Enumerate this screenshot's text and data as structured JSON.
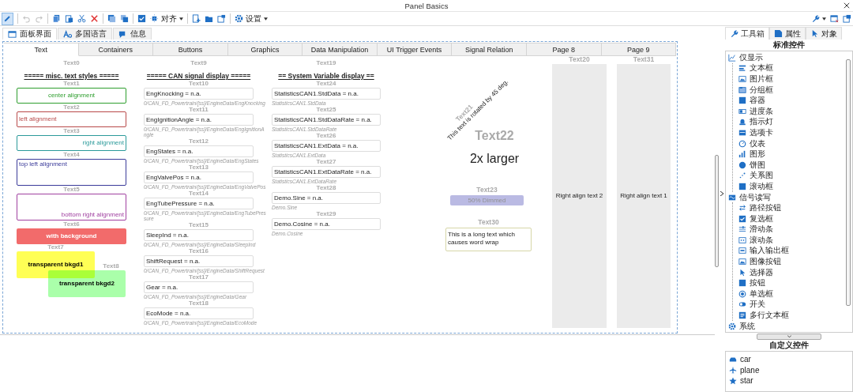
{
  "window": {
    "title": "Panel Basics"
  },
  "toolbar": {
    "edit_mode": true,
    "history": [
      {
        "disabled": true
      },
      {
        "disabled": true
      }
    ],
    "align_label": "对齐",
    "settings_label": "设置"
  },
  "view_tabs": [
    {
      "label": "面板界面",
      "selected": true
    },
    {
      "label": "多国语言",
      "selected": false
    },
    {
      "label": "信息",
      "selected": false
    }
  ],
  "page_tabs": [
    {
      "label": "Text",
      "selected": true
    },
    {
      "label": "Containers",
      "selected": false
    },
    {
      "label": "Buttons",
      "selected": false
    },
    {
      "label": "Graphics",
      "selected": false
    },
    {
      "label": "Data Manipulation",
      "selected": false
    },
    {
      "label": "UI Trigger Events",
      "selected": false
    },
    {
      "label": "Signal Relation",
      "selected": false
    },
    {
      "label": "Page 8",
      "selected": false
    },
    {
      "label": "Page 9",
      "selected": false
    }
  ],
  "canvas": {
    "widgets": [
      {
        "name": "Text0",
        "kind": "heading",
        "text": "===== misc. text styles ====="
      },
      {
        "name": "Text1",
        "kind": "center",
        "color": "#2e9e2e",
        "text": "center alignment"
      },
      {
        "name": "Text2",
        "kind": "left",
        "color": "#b94a4a",
        "text": "left alignment"
      },
      {
        "name": "Text3",
        "kind": "right",
        "color": "#2b9a9a",
        "text": "right alignment"
      },
      {
        "name": "Text4",
        "kind": "topleft",
        "color": "#3b3b9a",
        "text": "top left alignment"
      },
      {
        "name": "Text5",
        "kind": "bottomright",
        "color": "#a040a0",
        "text": "bottom right alignment"
      },
      {
        "name": "Text6",
        "kind": "filled",
        "color": "#f26b6b",
        "text": "with background"
      },
      {
        "name": "Text7",
        "kind": "overlay",
        "color": "#ffff55",
        "text": "transparent bkgd1"
      },
      {
        "name": "Text8",
        "kind": "overlay",
        "color": "#aaffaa",
        "text": "transparent bkgd2"
      },
      {
        "name": "Text9",
        "kind": "heading",
        "text": "===== CAN signal display ====="
      },
      {
        "name": "Text10",
        "kind": "signal",
        "text": "EngKnocking = n.a.",
        "caption": "0/CAN_FD_Powertrain/[ss]/EngineData/EngKnocking"
      },
      {
        "name": "Text11",
        "kind": "signal",
        "text": "EngIgnitionAngle = n.a.",
        "caption": "0/CAN_FD_Powertrain/[ss]/EngineData/EngIgnitionAngle"
      },
      {
        "name": "Text12",
        "kind": "signal",
        "text": "EngStates = n.a.",
        "caption": "0/CAN_FD_Powertrain/[ss]/EngineData/EngStates"
      },
      {
        "name": "Text13",
        "kind": "signal",
        "text": "EngValvePos = n.a.",
        "caption": "0/CAN_FD_Powertrain/[ss]/EngineData/EngValvePos"
      },
      {
        "name": "Text14",
        "kind": "signal",
        "text": "EngTubePressure = n.a.",
        "caption": "0/CAN_FD_Powertrain/[ss]/EngineData/EngTubePressure"
      },
      {
        "name": "Text15",
        "kind": "signal",
        "text": "SleepInd = n.a.",
        "caption": "0/CAN_FD_Powertrain/[ss]/EngineData/SleepInd"
      },
      {
        "name": "Text16",
        "kind": "signal",
        "text": "ShiftRequest = n.a.",
        "caption": "0/CAN_FD_Powertrain/[ss]/EngineData/ShiftRequest"
      },
      {
        "name": "Text17",
        "kind": "signal",
        "text": "Gear = n.a.",
        "caption": "0/CAN_FD_Powertrain/[ss]/EngineData/Gear"
      },
      {
        "name": "Text18",
        "kind": "signal",
        "text": "EcoMode = n.a.",
        "caption": "0/CAN_FD_Powertrain/[ss]/EngineData/EcoMode"
      },
      {
        "name": "Text19",
        "kind": "heading",
        "text": "== System Variable display =="
      },
      {
        "name": "Text24",
        "kind": "signal",
        "text": "StatisticsCAN1.StdData = n.a.",
        "caption": "StatisticsCAN1.StdData"
      },
      {
        "name": "Text25",
        "kind": "signal",
        "text": "StatisticsCAN1.StdDataRate = n.a.",
        "caption": "StatisticsCAN1.StdDataRate"
      },
      {
        "name": "Text26",
        "kind": "signal",
        "text": "StatisticsCAN1.ExtData = n.a.",
        "caption": "StatisticsCAN1.ExtData"
      },
      {
        "name": "Text27",
        "kind": "signal",
        "text": "StatisticsCAN1.ExtDataRate = n.a.",
        "caption": "StatisticsCAN1.ExtDataRate"
      },
      {
        "name": "Text28",
        "kind": "signal",
        "text": "Demo.Sine = n.a.",
        "caption": "Demo.Sine"
      },
      {
        "name": "Text29",
        "kind": "signal",
        "text": "Demo.Cosine = n.a.",
        "caption": "Demo.Cosine"
      },
      {
        "name": "Text21",
        "kind": "rotated",
        "text": "This text is rotated by 45 deg."
      },
      {
        "name": "Text22",
        "kind": "large",
        "text": "2x larger"
      },
      {
        "name": "Text23",
        "kind": "dimmed",
        "text": "50% Dimmed"
      },
      {
        "name": "Text30",
        "kind": "wrapped",
        "text": "This is a long text which causes word wrap"
      },
      {
        "name": "Text20",
        "kind": "tall",
        "text": "Right align text 2"
      },
      {
        "name": "Text31",
        "kind": "tall",
        "text": "Right align text 1"
      }
    ]
  },
  "toolbox": {
    "tabs": [
      {
        "label": "工具箱",
        "selected": true
      },
      {
        "label": "属性",
        "selected": false
      },
      {
        "label": "对象",
        "selected": false
      }
    ],
    "standard_title": "标准控件",
    "tree": [
      {
        "label": "仅显示",
        "children": [
          {
            "label": "文本框"
          },
          {
            "label": "图片框"
          },
          {
            "label": "分组框"
          },
          {
            "label": "容器"
          },
          {
            "label": "进度条"
          },
          {
            "label": "指示灯"
          },
          {
            "label": "选项卡"
          },
          {
            "label": "仪表"
          },
          {
            "label": "图形"
          },
          {
            "label": "饼图"
          },
          {
            "label": "关系图"
          },
          {
            "label": "滚动框"
          }
        ]
      },
      {
        "label": "信号读写",
        "children": [
          {
            "label": "路径按钮"
          },
          {
            "label": "复选框"
          },
          {
            "label": "滑动条"
          },
          {
            "label": "滚动条"
          },
          {
            "label": "输入输出框"
          },
          {
            "label": "图像按钮"
          },
          {
            "label": "选择器"
          },
          {
            "label": "按钮"
          },
          {
            "label": "单选框"
          },
          {
            "label": "开关"
          },
          {
            "label": "多行文本框"
          }
        ]
      },
      {
        "label": "系统"
      }
    ],
    "custom_title": "自定义控件",
    "custom_items": [
      {
        "label": "car"
      },
      {
        "label": "plane"
      },
      {
        "label": "star"
      }
    ]
  }
}
